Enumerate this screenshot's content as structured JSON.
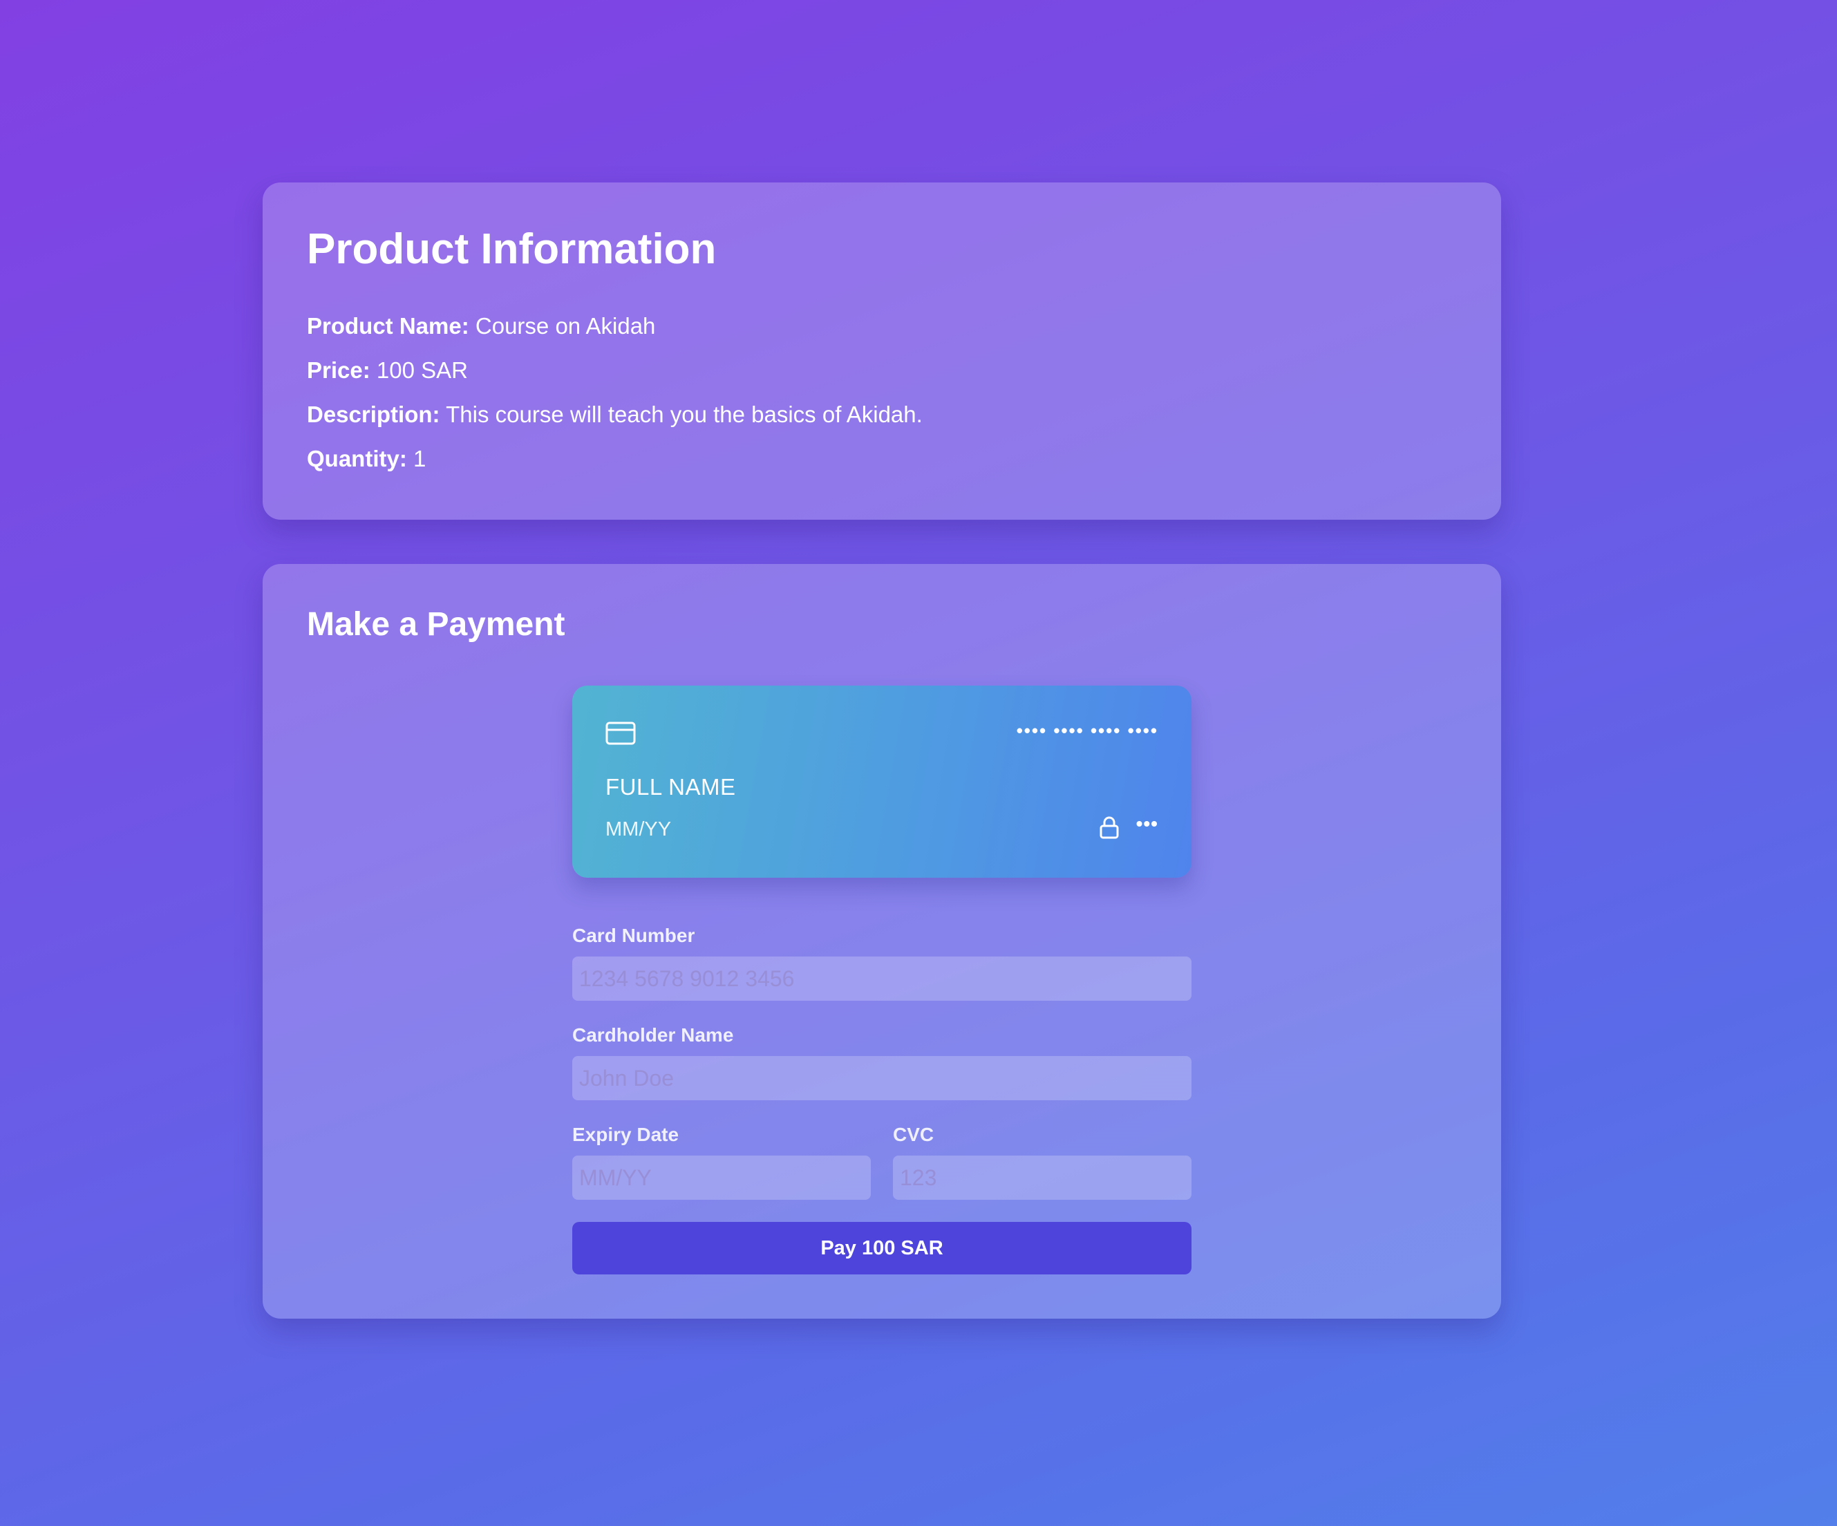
{
  "product": {
    "title": "Product Information",
    "name_label": "Product Name:",
    "name_value": "Course on Akidah",
    "price_label": "Price:",
    "price_value": "100 SAR",
    "description_label": "Description:",
    "description_value": "This course will teach you the basics of Akidah.",
    "quantity_label": "Quantity:",
    "quantity_value": "1"
  },
  "payment": {
    "title": "Make a Payment",
    "card_preview": {
      "icon": "credit-card-icon",
      "number_mask": "•••• •••• •••• ••••",
      "name": "FULL NAME",
      "expiry": "MM/YY",
      "lock_icon": "lock-icon",
      "cvc_mask": "•••",
      "gradient_start": "#52b4d2",
      "gradient_end": "#4f84ec"
    },
    "fields": {
      "card_number_label": "Card Number",
      "card_number_placeholder": "1234 5678 9012 3456",
      "cardholder_label": "Cardholder Name",
      "cardholder_placeholder": "John Doe",
      "expiry_label": "Expiry Date",
      "expiry_placeholder": "MM/YY",
      "cvc_label": "CVC",
      "cvc_placeholder": "123"
    },
    "pay_button_label": "Pay 100 SAR",
    "pay_button_color": "#4e44dc"
  }
}
